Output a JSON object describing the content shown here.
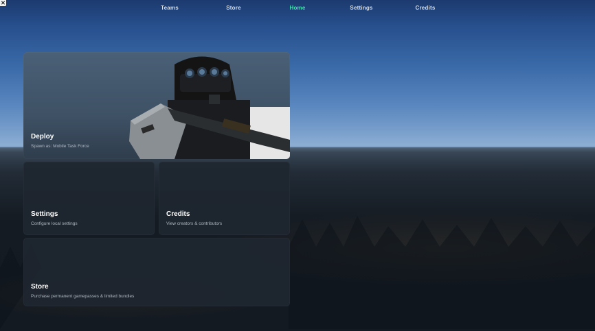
{
  "nav": {
    "tabs": [
      {
        "label": "Teams"
      },
      {
        "label": "Store"
      },
      {
        "label": "Home",
        "active": true
      },
      {
        "label": "Settings"
      },
      {
        "label": "Credits"
      }
    ]
  },
  "close_glyph": "✕",
  "cards": {
    "deploy": {
      "title": "Deploy",
      "subtitle": "Spawn as: Mobile Task Force"
    },
    "settings": {
      "title": "Settings",
      "subtitle": "Configure local settings"
    },
    "credits": {
      "title": "Credits",
      "subtitle": "View creators & contributors"
    },
    "store": {
      "title": "Store",
      "subtitle": "Purchase permanent gamepasses & limited bundles"
    }
  },
  "colors": {
    "active_tab": "#42e0b0",
    "card_bg": "#1e2630"
  }
}
